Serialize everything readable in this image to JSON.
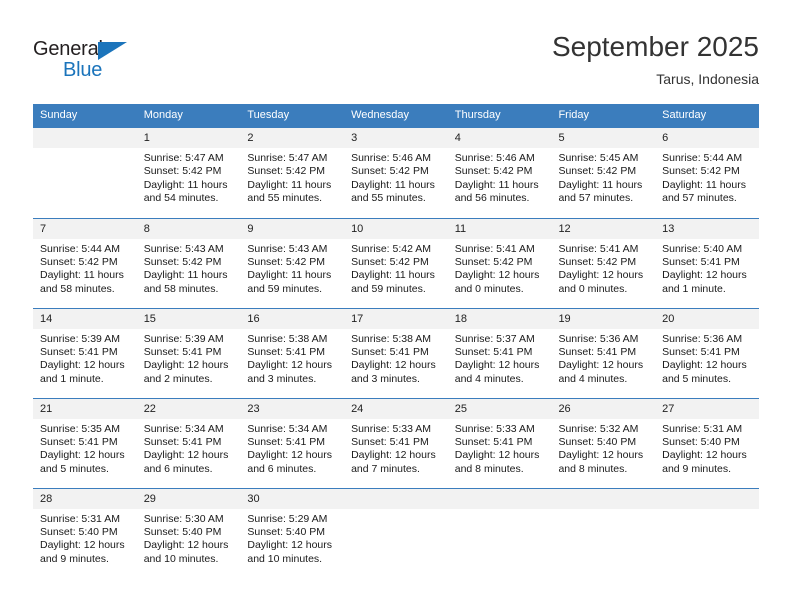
{
  "brand": {
    "name_part1": "General",
    "name_part2": "Blue",
    "triangle_icon": "triangle-icon",
    "accent_color": "#1b74bb"
  },
  "header": {
    "title": "September 2025",
    "subtitle": "Tarus, Indonesia"
  },
  "calendar": {
    "header_bg": "#3b7dbd",
    "daynum_bg": "#f2f2f2",
    "weekdays": [
      "Sunday",
      "Monday",
      "Tuesday",
      "Wednesday",
      "Thursday",
      "Friday",
      "Saturday"
    ],
    "weeks": [
      [
        {
          "day": "",
          "sunrise": "",
          "sunset": "",
          "daylight_line1": "",
          "daylight_line2": ""
        },
        {
          "day": "1",
          "sunrise": "Sunrise: 5:47 AM",
          "sunset": "Sunset: 5:42 PM",
          "daylight_line1": "Daylight: 11 hours",
          "daylight_line2": "and 54 minutes."
        },
        {
          "day": "2",
          "sunrise": "Sunrise: 5:47 AM",
          "sunset": "Sunset: 5:42 PM",
          "daylight_line1": "Daylight: 11 hours",
          "daylight_line2": "and 55 minutes."
        },
        {
          "day": "3",
          "sunrise": "Sunrise: 5:46 AM",
          "sunset": "Sunset: 5:42 PM",
          "daylight_line1": "Daylight: 11 hours",
          "daylight_line2": "and 55 minutes."
        },
        {
          "day": "4",
          "sunrise": "Sunrise: 5:46 AM",
          "sunset": "Sunset: 5:42 PM",
          "daylight_line1": "Daylight: 11 hours",
          "daylight_line2": "and 56 minutes."
        },
        {
          "day": "5",
          "sunrise": "Sunrise: 5:45 AM",
          "sunset": "Sunset: 5:42 PM",
          "daylight_line1": "Daylight: 11 hours",
          "daylight_line2": "and 57 minutes."
        },
        {
          "day": "6",
          "sunrise": "Sunrise: 5:44 AM",
          "sunset": "Sunset: 5:42 PM",
          "daylight_line1": "Daylight: 11 hours",
          "daylight_line2": "and 57 minutes."
        }
      ],
      [
        {
          "day": "7",
          "sunrise": "Sunrise: 5:44 AM",
          "sunset": "Sunset: 5:42 PM",
          "daylight_line1": "Daylight: 11 hours",
          "daylight_line2": "and 58 minutes."
        },
        {
          "day": "8",
          "sunrise": "Sunrise: 5:43 AM",
          "sunset": "Sunset: 5:42 PM",
          "daylight_line1": "Daylight: 11 hours",
          "daylight_line2": "and 58 minutes."
        },
        {
          "day": "9",
          "sunrise": "Sunrise: 5:43 AM",
          "sunset": "Sunset: 5:42 PM",
          "daylight_line1": "Daylight: 11 hours",
          "daylight_line2": "and 59 minutes."
        },
        {
          "day": "10",
          "sunrise": "Sunrise: 5:42 AM",
          "sunset": "Sunset: 5:42 PM",
          "daylight_line1": "Daylight: 11 hours",
          "daylight_line2": "and 59 minutes."
        },
        {
          "day": "11",
          "sunrise": "Sunrise: 5:41 AM",
          "sunset": "Sunset: 5:42 PM",
          "daylight_line1": "Daylight: 12 hours",
          "daylight_line2": "and 0 minutes."
        },
        {
          "day": "12",
          "sunrise": "Sunrise: 5:41 AM",
          "sunset": "Sunset: 5:42 PM",
          "daylight_line1": "Daylight: 12 hours",
          "daylight_line2": "and 0 minutes."
        },
        {
          "day": "13",
          "sunrise": "Sunrise: 5:40 AM",
          "sunset": "Sunset: 5:41 PM",
          "daylight_line1": "Daylight: 12 hours",
          "daylight_line2": "and 1 minute."
        }
      ],
      [
        {
          "day": "14",
          "sunrise": "Sunrise: 5:39 AM",
          "sunset": "Sunset: 5:41 PM",
          "daylight_line1": "Daylight: 12 hours",
          "daylight_line2": "and 1 minute."
        },
        {
          "day": "15",
          "sunrise": "Sunrise: 5:39 AM",
          "sunset": "Sunset: 5:41 PM",
          "daylight_line1": "Daylight: 12 hours",
          "daylight_line2": "and 2 minutes."
        },
        {
          "day": "16",
          "sunrise": "Sunrise: 5:38 AM",
          "sunset": "Sunset: 5:41 PM",
          "daylight_line1": "Daylight: 12 hours",
          "daylight_line2": "and 3 minutes."
        },
        {
          "day": "17",
          "sunrise": "Sunrise: 5:38 AM",
          "sunset": "Sunset: 5:41 PM",
          "daylight_line1": "Daylight: 12 hours",
          "daylight_line2": "and 3 minutes."
        },
        {
          "day": "18",
          "sunrise": "Sunrise: 5:37 AM",
          "sunset": "Sunset: 5:41 PM",
          "daylight_line1": "Daylight: 12 hours",
          "daylight_line2": "and 4 minutes."
        },
        {
          "day": "19",
          "sunrise": "Sunrise: 5:36 AM",
          "sunset": "Sunset: 5:41 PM",
          "daylight_line1": "Daylight: 12 hours",
          "daylight_line2": "and 4 minutes."
        },
        {
          "day": "20",
          "sunrise": "Sunrise: 5:36 AM",
          "sunset": "Sunset: 5:41 PM",
          "daylight_line1": "Daylight: 12 hours",
          "daylight_line2": "and 5 minutes."
        }
      ],
      [
        {
          "day": "21",
          "sunrise": "Sunrise: 5:35 AM",
          "sunset": "Sunset: 5:41 PM",
          "daylight_line1": "Daylight: 12 hours",
          "daylight_line2": "and 5 minutes."
        },
        {
          "day": "22",
          "sunrise": "Sunrise: 5:34 AM",
          "sunset": "Sunset: 5:41 PM",
          "daylight_line1": "Daylight: 12 hours",
          "daylight_line2": "and 6 minutes."
        },
        {
          "day": "23",
          "sunrise": "Sunrise: 5:34 AM",
          "sunset": "Sunset: 5:41 PM",
          "daylight_line1": "Daylight: 12 hours",
          "daylight_line2": "and 6 minutes."
        },
        {
          "day": "24",
          "sunrise": "Sunrise: 5:33 AM",
          "sunset": "Sunset: 5:41 PM",
          "daylight_line1": "Daylight: 12 hours",
          "daylight_line2": "and 7 minutes."
        },
        {
          "day": "25",
          "sunrise": "Sunrise: 5:33 AM",
          "sunset": "Sunset: 5:41 PM",
          "daylight_line1": "Daylight: 12 hours",
          "daylight_line2": "and 8 minutes."
        },
        {
          "day": "26",
          "sunrise": "Sunrise: 5:32 AM",
          "sunset": "Sunset: 5:40 PM",
          "daylight_line1": "Daylight: 12 hours",
          "daylight_line2": "and 8 minutes."
        },
        {
          "day": "27",
          "sunrise": "Sunrise: 5:31 AM",
          "sunset": "Sunset: 5:40 PM",
          "daylight_line1": "Daylight: 12 hours",
          "daylight_line2": "and 9 minutes."
        }
      ],
      [
        {
          "day": "28",
          "sunrise": "Sunrise: 5:31 AM",
          "sunset": "Sunset: 5:40 PM",
          "daylight_line1": "Daylight: 12 hours",
          "daylight_line2": "and 9 minutes."
        },
        {
          "day": "29",
          "sunrise": "Sunrise: 5:30 AM",
          "sunset": "Sunset: 5:40 PM",
          "daylight_line1": "Daylight: 12 hours",
          "daylight_line2": "and 10 minutes."
        },
        {
          "day": "30",
          "sunrise": "Sunrise: 5:29 AM",
          "sunset": "Sunset: 5:40 PM",
          "daylight_line1": "Daylight: 12 hours",
          "daylight_line2": "and 10 minutes."
        },
        {
          "day": "",
          "sunrise": "",
          "sunset": "",
          "daylight_line1": "",
          "daylight_line2": ""
        },
        {
          "day": "",
          "sunrise": "",
          "sunset": "",
          "daylight_line1": "",
          "daylight_line2": ""
        },
        {
          "day": "",
          "sunrise": "",
          "sunset": "",
          "daylight_line1": "",
          "daylight_line2": ""
        },
        {
          "day": "",
          "sunrise": "",
          "sunset": "",
          "daylight_line1": "",
          "daylight_line2": ""
        }
      ]
    ]
  }
}
